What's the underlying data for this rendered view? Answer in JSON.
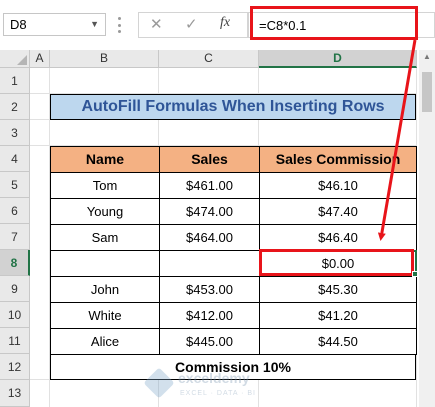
{
  "formula_bar": {
    "name_box": "D8",
    "cancel_glyph": "✕",
    "enter_glyph": "✓",
    "fx_label": "fx",
    "formula": "=C8*0.1"
  },
  "columns": [
    "A",
    "B",
    "C",
    "D"
  ],
  "rows": [
    "1",
    "2",
    "3",
    "4",
    "5",
    "6",
    "7",
    "8",
    "9",
    "10",
    "11",
    "12",
    "13"
  ],
  "sheet": {
    "title": "AutoFill Formulas When Inserting Rows",
    "headers": [
      "Name",
      "Sales",
      "Sales Commission"
    ],
    "data": [
      [
        "Tom",
        "$461.00",
        "$46.10"
      ],
      [
        "Young",
        "$474.00",
        "$47.40"
      ],
      [
        "Sam",
        "$464.00",
        "$46.40"
      ],
      [
        "",
        "",
        "$0.00"
      ],
      [
        "John",
        "$453.00",
        "$45.30"
      ],
      [
        "White",
        "$412.00",
        "$41.20"
      ],
      [
        "Alice",
        "$445.00",
        "$44.50"
      ]
    ],
    "footer": "Commission 10%"
  },
  "watermark": {
    "name": "exceldemy",
    "tagline": "EXCEL · DATA · BI"
  },
  "colors": {
    "header_fill": "#f4b183",
    "title_fill": "#bdd7ee",
    "title_text": "#2f5597",
    "highlight": "#e8141a",
    "selection": "#217346"
  },
  "icons": [
    "name-box-dropdown-icon",
    "cancel-icon",
    "enter-icon",
    "fx-icon",
    "select-all-icon",
    "scroll-up-icon"
  ]
}
